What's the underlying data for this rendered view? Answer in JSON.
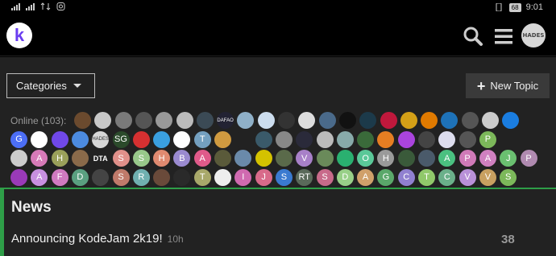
{
  "status_bar": {
    "left_icons": [
      "signal-icon",
      "signal-icon",
      "data-icon",
      "instagram-icon"
    ],
    "battery": "68",
    "time": "9:01"
  },
  "header": {
    "logo_letter": "k",
    "right_icons": [
      "search-icon",
      "menu-icon"
    ],
    "user_avatar_text": "HADES"
  },
  "toolbar": {
    "categories_label": "Categories",
    "new_topic_label": "New Topic"
  },
  "online": {
    "label": "Online (103):",
    "rows": [
      [
        {
          "t": "",
          "c": "#6b4a2e"
        },
        {
          "t": "",
          "c": "#c8c8c8"
        },
        {
          "t": "",
          "c": "#7a7a7a"
        },
        {
          "t": "",
          "c": "#555"
        },
        {
          "t": "",
          "c": "#999"
        },
        {
          "t": "",
          "c": "#bbb"
        },
        {
          "t": "",
          "c": "#3b4a55"
        },
        {
          "t": "DAFAO",
          "c": "#223"
        },
        {
          "t": "",
          "c": "#8fb0c8"
        },
        {
          "t": "",
          "c": "#cde"
        },
        {
          "t": "",
          "c": "#333"
        },
        {
          "t": "",
          "c": "#ddd"
        },
        {
          "t": "",
          "c": "#4a6a8a"
        },
        {
          "t": "",
          "c": "#111"
        },
        {
          "t": "",
          "c": "#1c3a4a"
        },
        {
          "t": "",
          "c": "#c0183c"
        },
        {
          "t": "",
          "c": "#d4a017"
        },
        {
          "t": "",
          "c": "#e07a00"
        },
        {
          "t": "",
          "c": "#1e72b8"
        },
        {
          "t": "",
          "c": "#555"
        },
        {
          "t": "",
          "c": "#ccc"
        },
        {
          "t": "",
          "c": "#1a7de0"
        }
      ],
      [
        {
          "t": "G",
          "c": "#4c6ef5"
        },
        {
          "t": "",
          "c": "#fff"
        },
        {
          "t": "",
          "c": "#7048e8"
        },
        {
          "t": "",
          "c": "#4c8be0"
        },
        {
          "t": "HADES",
          "c": "#d7d7d7"
        },
        {
          "t": "SG",
          "c": "#2b4a2b"
        },
        {
          "t": "",
          "c": "#d63031"
        },
        {
          "t": "",
          "c": "#3aa0e0"
        },
        {
          "t": "",
          "c": "#fff"
        },
        {
          "t": "T",
          "c": "#74a0c0"
        },
        {
          "t": "",
          "c": "#d09a40"
        },
        {
          "t": "",
          "c": "#222"
        },
        {
          "t": "",
          "c": "#3a5a6a"
        },
        {
          "t": "",
          "c": "#888"
        },
        {
          "t": "",
          "c": "#2a2a3a"
        },
        {
          "t": "",
          "c": "#bbb"
        },
        {
          "t": "",
          "c": "#8aa"
        },
        {
          "t": "",
          "c": "#3a6a3a"
        },
        {
          "t": "",
          "c": "#e67e22"
        },
        {
          "t": "",
          "c": "#aa44dd"
        },
        {
          "t": "",
          "c": "#444"
        },
        {
          "t": "",
          "c": "#dde"
        },
        {
          "t": "",
          "c": "#555"
        },
        {
          "t": "P",
          "c": "#7cb85a"
        }
      ],
      [
        {
          "t": "",
          "c": "#ccc"
        },
        {
          "t": "A",
          "c": "#d77ab8"
        },
        {
          "t": "H",
          "c": "#9aa05a"
        },
        {
          "t": "",
          "c": "#8a6a4a"
        },
        {
          "t": "DTA",
          "c": "#222"
        },
        {
          "t": "S",
          "c": "#e0908a"
        },
        {
          "t": "S",
          "c": "#98c88a"
        },
        {
          "t": "H",
          "c": "#e08a70"
        },
        {
          "t": "B",
          "c": "#9a8ad0"
        },
        {
          "t": "A",
          "c": "#e05a8a"
        },
        {
          "t": "",
          "c": "#5a5a3a"
        },
        {
          "t": "",
          "c": "#6a8aaa"
        },
        {
          "t": "",
          "c": "#d4c200"
        },
        {
          "t": "",
          "c": "#5a6a4a"
        },
        {
          "t": "V",
          "c": "#a880c8"
        },
        {
          "t": "",
          "c": "#6a8a5a"
        },
        {
          "t": "",
          "c": "#2ab070"
        },
        {
          "t": "O",
          "c": "#5ac898"
        },
        {
          "t": "H",
          "c": "#9a9a9a"
        },
        {
          "t": "",
          "c": "#3a5a3a"
        },
        {
          "t": "",
          "c": "#4a5a6a"
        },
        {
          "t": "A",
          "c": "#4ac080"
        },
        {
          "t": "P",
          "c": "#d07ab8"
        },
        {
          "t": "A",
          "c": "#d080c0"
        },
        {
          "t": "J",
          "c": "#6ac070"
        },
        {
          "t": "P",
          "c": "#b08ab0"
        }
      ],
      [
        {
          "t": "",
          "c": "#9a3ab8"
        },
        {
          "t": "A",
          "c": "#c890e0"
        },
        {
          "t": "F",
          "c": "#d07ac0"
        },
        {
          "t": "D",
          "c": "#5aa080"
        },
        {
          "t": "",
          "c": "#444"
        },
        {
          "t": "S",
          "c": "#c07a6a"
        },
        {
          "t": "R",
          "c": "#70b0b0"
        },
        {
          "t": "",
          "c": "#6a4a3a"
        },
        {
          "t": "",
          "c": "#2a2a2a"
        },
        {
          "t": "T",
          "c": "#a8a86a"
        },
        {
          "t": "",
          "c": "#eee"
        },
        {
          "t": "I",
          "c": "#d06ab0"
        },
        {
          "t": "J",
          "c": "#d86a8a"
        },
        {
          "t": "S",
          "c": "#3a7ad0"
        },
        {
          "t": "RT",
          "c": "#5a6a5a"
        },
        {
          "t": "S",
          "c": "#c86a8a"
        },
        {
          "t": "D",
          "c": "#98d088"
        },
        {
          "t": "A",
          "c": "#d0a06a"
        },
        {
          "t": "G",
          "c": "#5aa86a"
        },
        {
          "t": "C",
          "c": "#9080d0"
        },
        {
          "t": "T",
          "c": "#90c86a"
        },
        {
          "t": "C",
          "c": "#6ab08a"
        },
        {
          "t": "V",
          "c": "#b890d8"
        },
        {
          "t": "V",
          "c": "#c8a060"
        },
        {
          "t": "S",
          "c": "#7cb85a"
        }
      ]
    ]
  },
  "news": {
    "title": "News",
    "topic_title": "Announcing KodeJam 2k19!",
    "topic_time": "10h",
    "topic_count": "38"
  }
}
